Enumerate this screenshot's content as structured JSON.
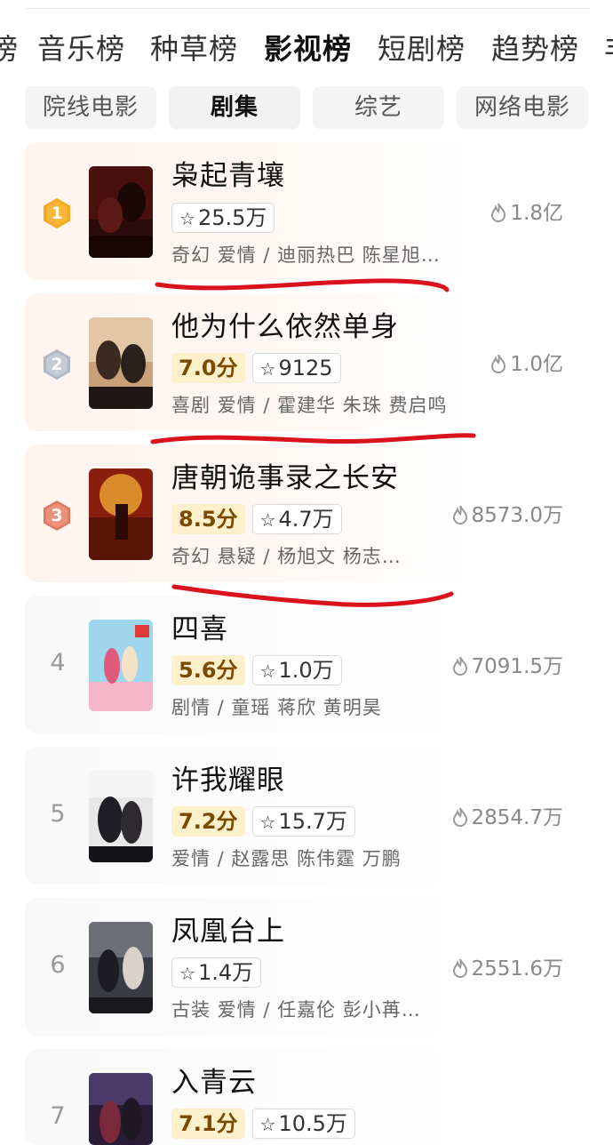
{
  "tabs": [
    "榜",
    "音乐榜",
    "种草榜",
    "影视榜",
    "短剧榜",
    "趋势榜",
    "丰"
  ],
  "active_tab": "影视榜",
  "subtabs": [
    "院线电影",
    "剧集",
    "综艺",
    "网络电影"
  ],
  "active_subtab": "剧集",
  "items": [
    {
      "rank": "1",
      "title": "枭起青壤",
      "score": "",
      "want": "25.5万",
      "meta": "奇幻 爱情 / 迪丽热巴 陈星旭…",
      "heat": "1.8亿"
    },
    {
      "rank": "2",
      "title": "他为什么依然单身",
      "score": "7.0分",
      "want": "9125",
      "meta": "喜剧 爱情 / 霍建华 朱珠 费启鸣",
      "heat": "1.0亿"
    },
    {
      "rank": "3",
      "title": "唐朝诡事录之长安",
      "score": "8.5分",
      "want": "4.7万",
      "meta": "奇幻 悬疑 / 杨旭文 杨志…",
      "heat": "8573.0万"
    },
    {
      "rank": "4",
      "title": "四喜",
      "score": "5.6分",
      "want": "1.0万",
      "meta": "剧情 / 童瑶 蒋欣 黄明昊",
      "heat": "7091.5万"
    },
    {
      "rank": "5",
      "title": "许我耀眼",
      "score": "7.2分",
      "want": "15.7万",
      "meta": "爱情 / 赵露思 陈伟霆 万鹏",
      "heat": "2854.7万"
    },
    {
      "rank": "6",
      "title": "凤凰台上",
      "score": "",
      "want": "1.4万",
      "meta": "古装 爱情 / 任嘉伦 彭小苒…",
      "heat": "2551.6万"
    },
    {
      "rank": "7",
      "title": "入青云",
      "score": "7.1分",
      "want": "10.5万",
      "meta": "",
      "heat": ""
    }
  ],
  "icons": {
    "rank_top": "hexagon-medal-icon",
    "want": "star-icon",
    "heat": "flame-icon"
  },
  "colors": {
    "gold": "#f5a623",
    "silver": "#b8bfcc",
    "bronze": "#e8846a",
    "score_bg": "#fff0cc",
    "annotation": "#d9121b"
  }
}
